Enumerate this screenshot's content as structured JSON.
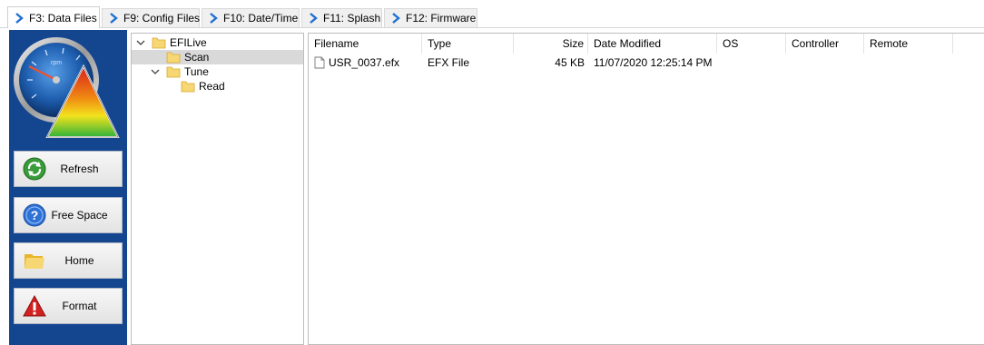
{
  "tabs": [
    {
      "label": "F3: Data Files",
      "active": true
    },
    {
      "label": "F9: Config Files",
      "active": false
    },
    {
      "label": "F10: Date/Time",
      "active": false
    },
    {
      "label": "F11: Splash",
      "active": false
    },
    {
      "label": "F12: Firmware",
      "active": false
    }
  ],
  "sidebar": {
    "buttons": [
      {
        "label": "Refresh",
        "icon": "refresh-icon"
      },
      {
        "label": "Free Space",
        "icon": "help-icon"
      },
      {
        "label": "Home",
        "icon": "folder-icon"
      },
      {
        "label": "Format",
        "icon": "warning-icon"
      }
    ],
    "logo": {
      "gauge_text": "rpm"
    }
  },
  "tree": {
    "items": [
      {
        "label": "EFILive",
        "expanded": true,
        "selected": false
      },
      {
        "label": "Scan",
        "selected": true
      },
      {
        "label": "Tune",
        "expanded": true,
        "selected": false
      },
      {
        "label": "Read",
        "selected": false
      }
    ]
  },
  "filelist": {
    "columns": [
      "Filename",
      "Type",
      "Size",
      "Date Modified",
      "OS",
      "Controller",
      "Remote"
    ],
    "rows": [
      {
        "filename": "USR_0037.efx",
        "type": "EFX File",
        "size": "45 KB",
        "modified": "11/07/2020 12:25:14 PM",
        "os": "",
        "controller": "",
        "remote": ""
      }
    ]
  },
  "colors": {
    "panel_blue": "#14468f",
    "chevron_blue": "#1f6fd1",
    "folder_yellow": "#f7d774"
  }
}
